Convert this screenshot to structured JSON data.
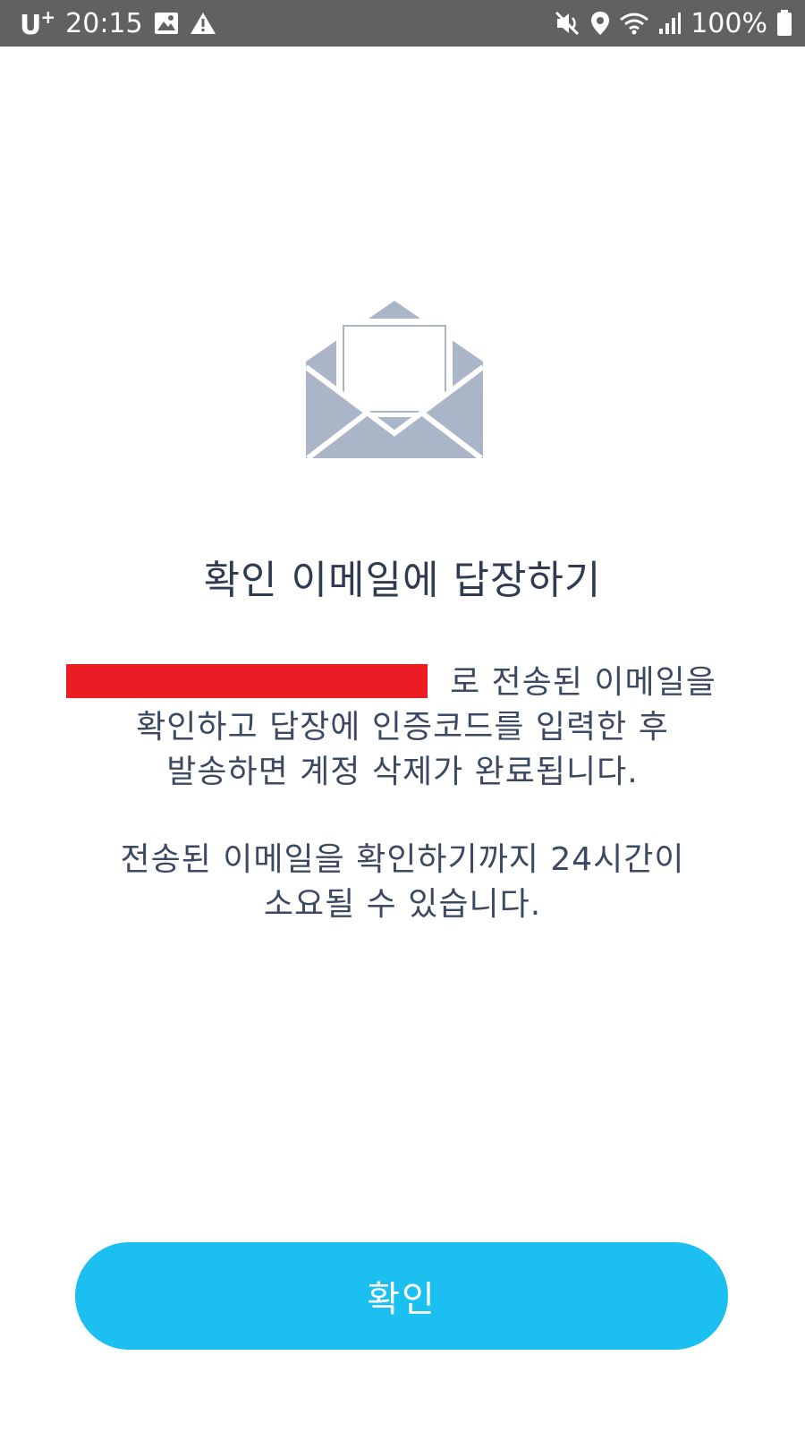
{
  "status_bar": {
    "carrier": "U",
    "carrier_sup": "+",
    "time": "20:15",
    "battery_text": "100%",
    "icons": [
      "gallery-icon",
      "warning-icon",
      "mute-icon",
      "location-icon",
      "wifi-icon",
      "signal-icon",
      "battery-icon"
    ]
  },
  "main": {
    "icon": "open-envelope-icon",
    "title": "확인 이메일에 답장하기",
    "desc_lines": [
      "로 전송된 이메일을",
      "확인하고 답장에 인증코드를 입력한 후",
      "발송하면 계정 삭제가 완료됩니다."
    ],
    "note_lines": [
      "전송된 이메일을 확인하기까지 24시간이",
      "소요될 수 있습니다."
    ]
  },
  "confirm_button": {
    "label": "확인"
  },
  "colors": {
    "status_bar_bg": "#616161",
    "icon_gray": "#aab5c8",
    "title_text": "#2f3b52",
    "body_text": "#3c4963",
    "button_bg": "#1bbff0",
    "redaction": "#ec1c24"
  }
}
